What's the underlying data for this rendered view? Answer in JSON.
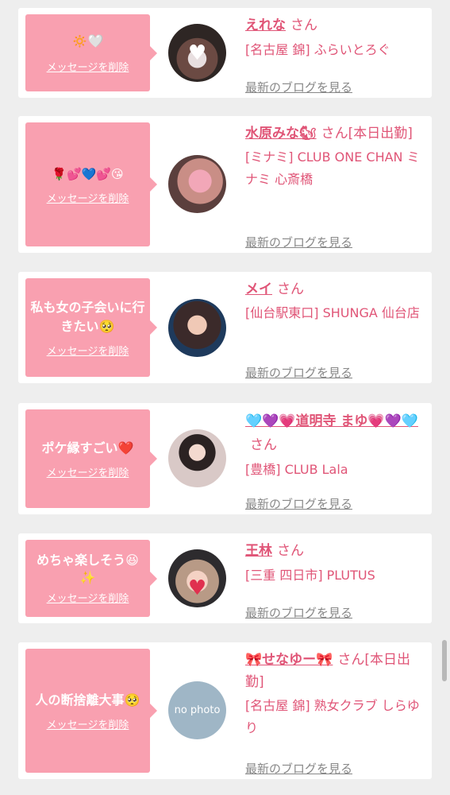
{
  "cards": [
    {
      "message": "🔅🤍",
      "delete_label": "メッセージを削除",
      "name": "えれな",
      "san": "さん",
      "shop": "[名古屋 錦] ふらいとろぐ",
      "blog_link": "最新のブログを見る"
    },
    {
      "message": "🌹💕💙💕😘",
      "delete_label": "メッセージを削除",
      "name": "水原みな🐿",
      "san": "さん[本日出勤]",
      "shop": "[ミナミ] CLUB ONE CHAN ミナミ 心斎橋",
      "blog_link": "最新のブログを見る"
    },
    {
      "message": "私も女の子会いに行きたい🥺",
      "delete_label": "メッセージを削除",
      "name": "メイ",
      "san": "さん",
      "shop": "[仙台駅東口] SHUNGA 仙台店",
      "blog_link": "最新のブログを見る"
    },
    {
      "message": "ポケ縁すごい❤️",
      "delete_label": "メッセージを削除",
      "name": "🩵💜💗道明寺 まゆ💗💜🩵",
      "san": "さん",
      "shop": "[豊橋] CLUB Lala",
      "blog_link": "最新のブログを見る"
    },
    {
      "message": "めちゃ楽しそう😆✨",
      "delete_label": "メッセージを削除",
      "name": "王林",
      "san": "さん",
      "shop": "[三重 四日市] PLUTUS",
      "blog_link": "最新のブログを見る"
    },
    {
      "message": "人の断捨離大事🥺",
      "delete_label": "メッセージを削除",
      "name": "🎀せなゆー🎀",
      "san": "さん[本日出勤]",
      "shop": "[名古屋 錦] 熟女クラブ しらゆり",
      "blog_link": "最新のブログを見る",
      "avatar_text": "no photo"
    }
  ],
  "colors": {
    "bubble": "#f9a0b0",
    "name": "#e05577",
    "link": "#888888",
    "background": "#eeeeee"
  }
}
